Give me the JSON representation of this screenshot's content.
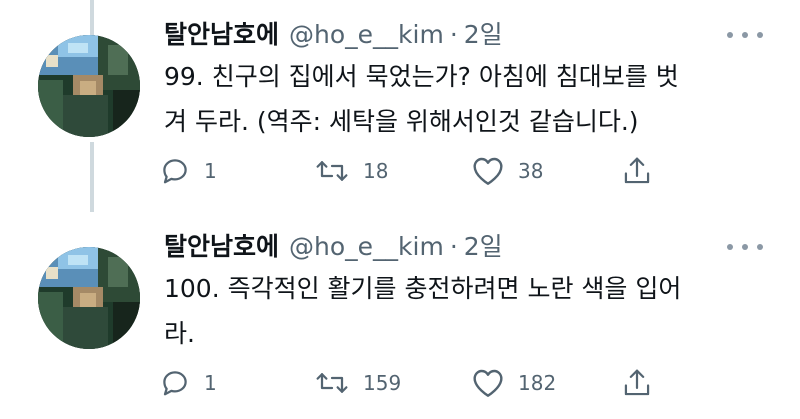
{
  "tweets": [
    {
      "author_name": "탈안남호에",
      "handle": "@ho_e__kim",
      "separator": "·",
      "time": "2일",
      "text_lines": [
        "99. 친구의 집에서 묵었는가? 아침에 침대보를 벗",
        "겨 두라. (역주: 세탁을 위해서인것 같습니다.)"
      ],
      "replies": "1",
      "retweets": "18",
      "likes": "38"
    },
    {
      "author_name": "탈안남호에",
      "handle": "@ho_e__kim",
      "separator": "·",
      "time": "2일",
      "text_lines": [
        "100. 즉각적인 활기를 충전하려면 노란 색을 입어",
        "라."
      ],
      "replies": "1",
      "retweets": "159",
      "likes": "182"
    }
  ],
  "icons": {
    "reply": "reply-icon",
    "retweet": "retweet-icon",
    "like": "heart-icon",
    "share": "share-icon",
    "more": "more-icon"
  },
  "colors": {
    "text": "#0f1419",
    "secondary": "#536471",
    "thread_line": "#cfd9de"
  }
}
